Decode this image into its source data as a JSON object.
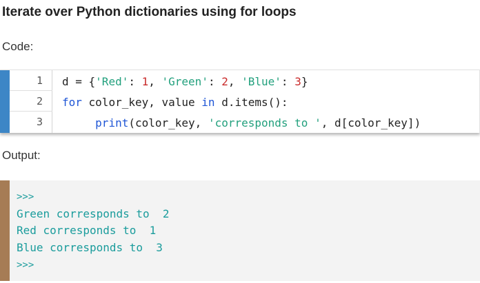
{
  "title": "Iterate over Python dictionaries using for loops",
  "code_label": "Code:",
  "output_label": "Output:",
  "code": {
    "line_numbers": [
      "1",
      "2",
      "3"
    ],
    "lines": [
      {
        "tokens": [
          {
            "text": "d = {",
            "kind": "plain"
          },
          {
            "text": "'Red'",
            "kind": "str"
          },
          {
            "text": ": ",
            "kind": "plain"
          },
          {
            "text": "1",
            "kind": "num"
          },
          {
            "text": ", ",
            "kind": "plain"
          },
          {
            "text": "'Green'",
            "kind": "str"
          },
          {
            "text": ": ",
            "kind": "plain"
          },
          {
            "text": "2",
            "kind": "num"
          },
          {
            "text": ", ",
            "kind": "plain"
          },
          {
            "text": "'Blue'",
            "kind": "str"
          },
          {
            "text": ": ",
            "kind": "plain"
          },
          {
            "text": "3",
            "kind": "num"
          },
          {
            "text": "}",
            "kind": "plain"
          }
        ]
      },
      {
        "tokens": [
          {
            "text": "for",
            "kind": "kw"
          },
          {
            "text": " color_key, value ",
            "kind": "plain"
          },
          {
            "text": "in",
            "kind": "kw"
          },
          {
            "text": " d.items():",
            "kind": "plain"
          }
        ]
      },
      {
        "tokens": [
          {
            "text": "     ",
            "kind": "plain"
          },
          {
            "text": "print",
            "kind": "fn"
          },
          {
            "text": "(color_key, ",
            "kind": "plain"
          },
          {
            "text": "'corresponds to '",
            "kind": "str"
          },
          {
            "text": ", d[color_key])",
            "kind": "plain"
          }
        ]
      }
    ]
  },
  "output": {
    "lines": [
      ">>>",
      "Green corresponds to  2",
      "Red corresponds to  1",
      "Blue corresponds to  3",
      ">>>"
    ]
  },
  "colors": {
    "code_accent": "#3d86c6",
    "output_accent": "#a67c55",
    "keyword": "#1f56d6",
    "string": "#22a07d",
    "number": "#c92a2a",
    "output_text": "#1a9c9c",
    "output_bg": "#f3f3f3"
  }
}
